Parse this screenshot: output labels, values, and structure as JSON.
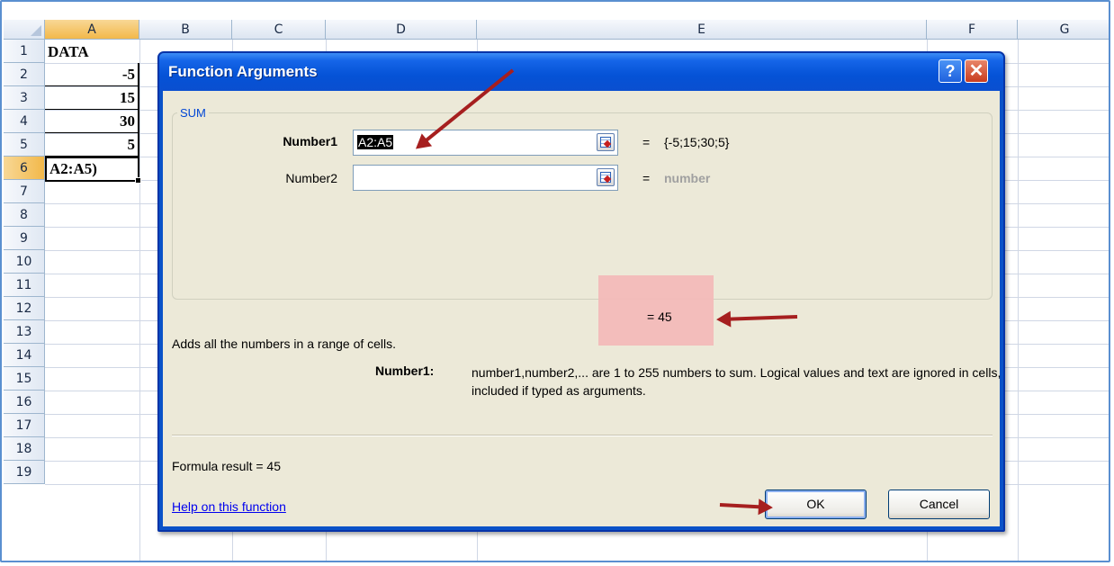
{
  "sheet": {
    "columns": [
      "A",
      "B",
      "C",
      "D",
      "E",
      "F",
      "G"
    ],
    "rows": [
      "1",
      "2",
      "3",
      "4",
      "5",
      "6",
      "7",
      "8",
      "9",
      "10",
      "11",
      "12",
      "13",
      "14",
      "15",
      "16",
      "17",
      "18",
      "19"
    ],
    "cells": {
      "a1": "DATA",
      "a2": "-5",
      "a3": "15",
      "a4": "30",
      "a5": "5",
      "a6": "A2:A5)"
    }
  },
  "dialog": {
    "title": "Function Arguments",
    "help_button": "?",
    "close_button": "✕",
    "function_name": "SUM",
    "args": [
      {
        "label": "Number1",
        "value": "A2:A5",
        "result": "{-5;15;30;5}"
      },
      {
        "label": "Number2",
        "value": "",
        "result": "number"
      }
    ],
    "equals": "=",
    "result_line": "=  45",
    "description": "Adds all the numbers in a range of cells.",
    "arg_help_name": "Number1:",
    "arg_help_text": "number1,number2,... are 1 to 255 numbers to sum. Logical values and text are ignored in cells, included if typed as arguments.",
    "formula_result": "Formula result =   45",
    "help_link": "Help on this function",
    "ok_label": "OK",
    "cancel_label": "Cancel"
  },
  "colors": {
    "title_bar": "#0a52c8",
    "dialog_bg": "#ece9d8",
    "highlight": "#f4b8b8",
    "arrow": "#a61f1f",
    "selected_header": "#f2b84a"
  }
}
